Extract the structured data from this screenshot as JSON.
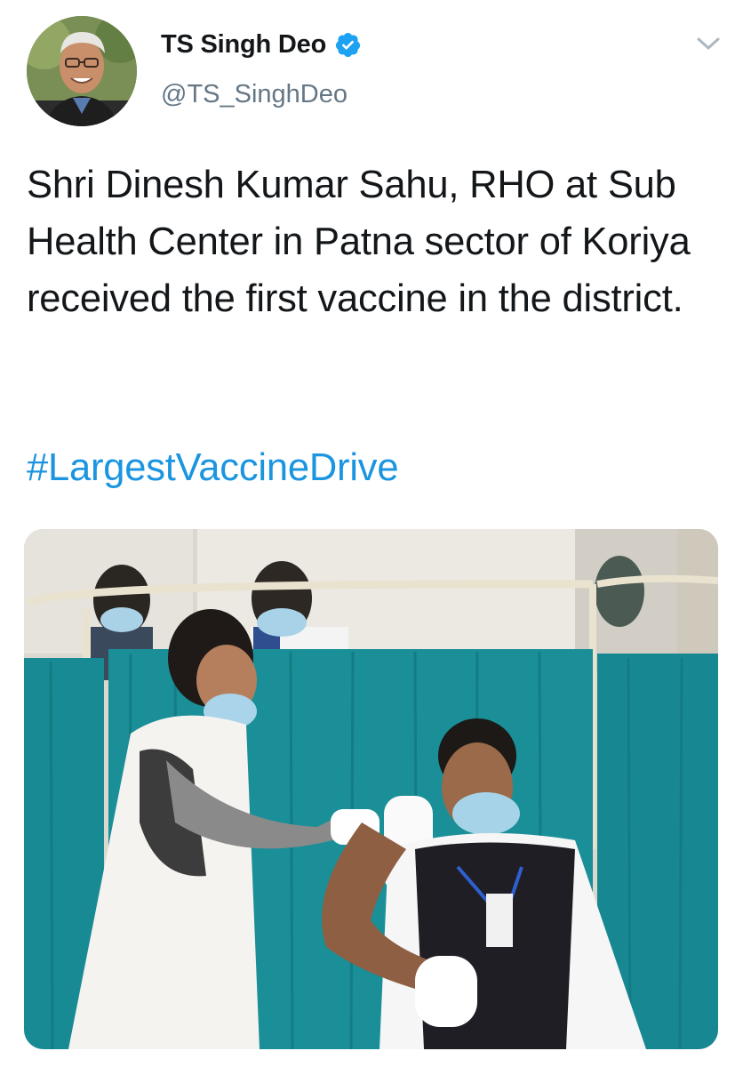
{
  "tweet": {
    "author": {
      "display_name": "TS Singh Deo",
      "handle": "@TS_SinghDeo",
      "verified": true,
      "avatar_icon": "profile-photo"
    },
    "text": "Shri Dinesh Kumar Sahu, RHO at Sub Health Center in Patna sector of Koriya received the first vaccine in the district.",
    "hashtag": "#LargestVaccineDrive",
    "menu_icon": "chevron-down-icon",
    "media": {
      "type": "photo",
      "icon": "photo-health-worker-vaccination"
    }
  },
  "colors": {
    "text_primary": "#14171a",
    "text_secondary": "#657786",
    "link": "#1b95e0",
    "verified_badge": "#1da1f2",
    "caret": "#aab8c2",
    "curtain": "#1d8a93"
  }
}
